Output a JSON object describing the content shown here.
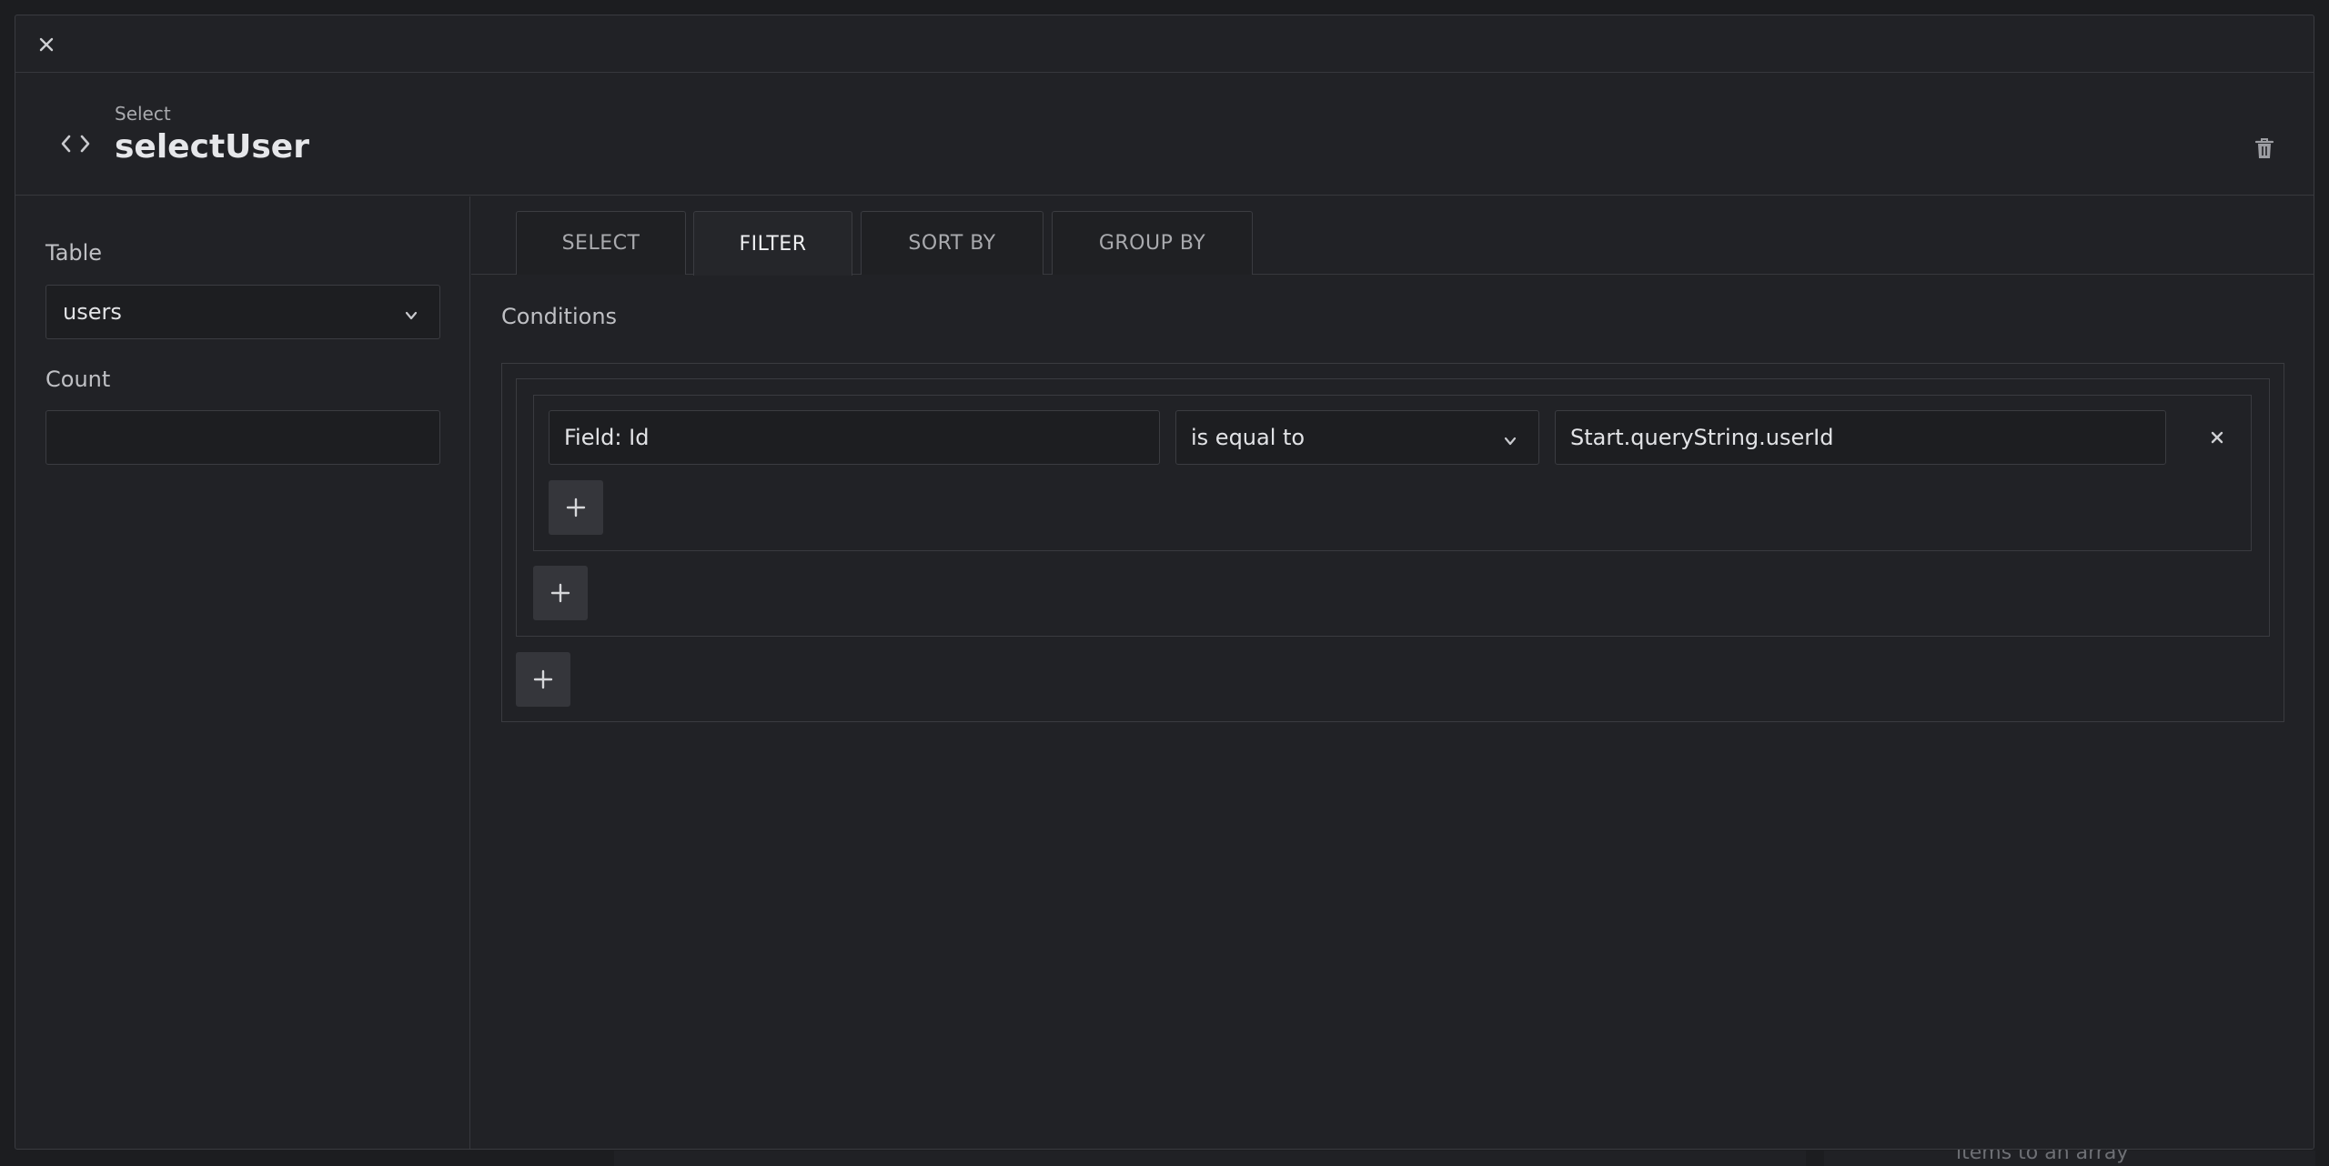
{
  "background": {
    "peek_text": "items to an array"
  },
  "modal": {
    "close_icon": "close-icon",
    "header": {
      "subtitle": "Select",
      "title": "selectUser",
      "code_icon": "code-icon",
      "delete_icon": "trash-icon"
    },
    "left_panel": {
      "table_label": "Table",
      "table_value": "users",
      "count_label": "Count",
      "count_value": ""
    },
    "tabs": [
      {
        "label": "SELECT",
        "active": false
      },
      {
        "label": "FILTER",
        "active": true
      },
      {
        "label": "SORT BY",
        "active": false
      },
      {
        "label": "GROUP BY",
        "active": false
      }
    ],
    "filter": {
      "conditions_label": "Conditions",
      "rule": {
        "field": "Field: Id",
        "operator": "is equal to",
        "value": "Start.queryString.userId"
      }
    }
  },
  "colors": {
    "background": "#1c1d20",
    "modal": "#212226",
    "border": "#3a3b40",
    "button": "#35363b",
    "text": "#e2e3e6"
  }
}
